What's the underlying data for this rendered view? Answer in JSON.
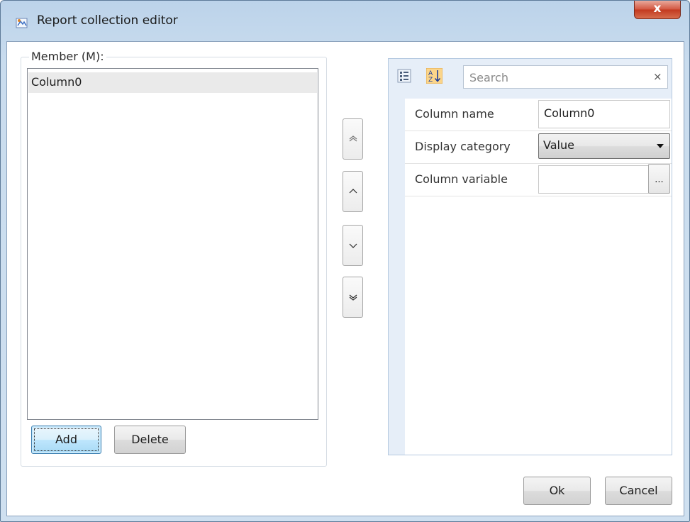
{
  "window": {
    "title": "Report collection editor",
    "close_label": "x"
  },
  "members": {
    "legend": "Member (M):",
    "items": [
      {
        "label": "Column0",
        "selected": true
      }
    ],
    "add_label": "Add",
    "delete_label": "Delete"
  },
  "move_buttons": {
    "top_icon": "double-chevron-up-icon",
    "up_icon": "chevron-up-icon",
    "down_icon": "chevron-down-icon",
    "bottom_icon": "double-chevron-down-icon"
  },
  "property_grid": {
    "toolbar": {
      "categorized_icon": "categorized-view-icon",
      "alphabetical_icon": "sort-alphabetical-icon"
    },
    "search": {
      "placeholder": "Search",
      "value": "",
      "clear_label": "×"
    },
    "rows": [
      {
        "name": "Column name",
        "value": "Column0",
        "editor": "text"
      },
      {
        "name": "Display category",
        "value": "Value",
        "editor": "dropdown"
      },
      {
        "name": "Column variable",
        "value": "",
        "editor": "ellipsis",
        "button_label": "..."
      }
    ]
  },
  "footer": {
    "ok_label": "Ok",
    "cancel_label": "Cancel"
  },
  "colors": {
    "titlebar": "#c9dcee",
    "close_button": "#d2553f",
    "selection": "#eaeaea",
    "focused_button": "#bee6fd",
    "grid_gutter": "#e6eef8"
  }
}
